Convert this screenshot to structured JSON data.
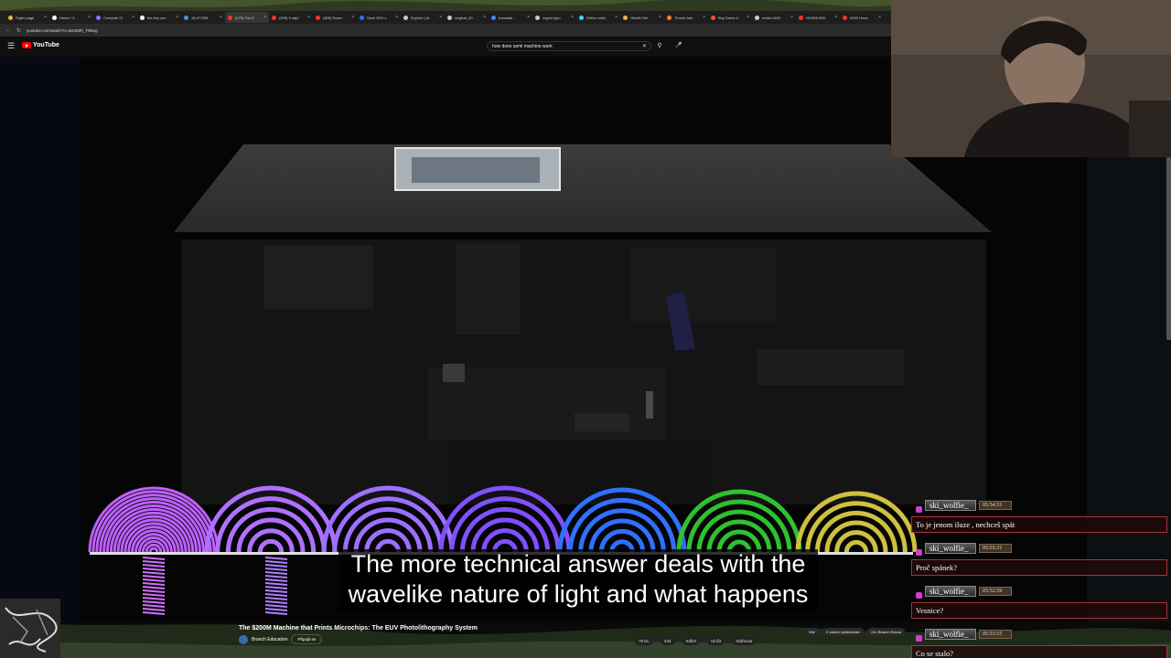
{
  "browser": {
    "tabs": [
      {
        "label": "Pajier page",
        "color": "#e8b84a"
      },
      {
        "label": "Home / X",
        "color": "#ffffff"
      },
      {
        "label": "Compute Cl",
        "color": "#7a7aff"
      },
      {
        "label": "the tiny cou",
        "color": "#ffffff"
      },
      {
        "label": "15 #71351 ",
        "color": "#4a90e2"
      },
      {
        "label": "(275) The E",
        "color": "#ff3030",
        "active": true
      },
      {
        "label": "(305) 3 najd",
        "color": "#ff3030"
      },
      {
        "label": "(305) Down",
        "color": "#ff3030"
      },
      {
        "label": "Save 20% o",
        "color": "#2f6fff"
      },
      {
        "label": "Explore | Ar",
        "color": "#cccccc"
      },
      {
        "label": "original_29",
        "color": "#cccccc"
      },
      {
        "label": "translate - ",
        "color": "#4285f4"
      },
      {
        "label": "crypto typo",
        "color": "#cccccc"
      },
      {
        "label": "Online zetic",
        "color": "#3ad8ff"
      },
      {
        "label": "Hlinčik Onl",
        "color": "#e8b84a"
      },
      {
        "label": "Trench fast",
        "color": "#ff8030"
      },
      {
        "label": "Buy Dome h",
        "color": "#ff5030"
      },
      {
        "label": "nvidia b200",
        "color": "#cccccc"
      },
      {
        "label": "NVIDIA B20",
        "color": "#ff3030"
      },
      {
        "label": "4090 Hood ",
        "color": "#ff3030"
      }
    ],
    "url": "youtube.com/watch?v=B2482h_TRkeg"
  },
  "youtube": {
    "logo_text": "YouTube",
    "search_value": "how does asml machine work",
    "video": {
      "subtitle_line1": "The more technical answer deals with the",
      "subtitle_line2": "wavelike nature of light and what happens",
      "title": "The $200M Machine that Prints Microchips: The EUV Photolithography System",
      "channel": "Branch Education",
      "join_label": "Připojit se",
      "actions": [
        "78 tis.",
        "234",
        "Sdílet",
        "Uložit",
        "Stáhnout"
      ],
      "chips": [
        "Vše",
        "Z vašich vyhledávání",
        "Od: Branch Educa"
      ],
      "arc_colors": [
        "#c060ff",
        "#b070ff",
        "#9c70ff",
        "#8050ff",
        "#3070ff",
        "#30c030",
        "#d0c040"
      ]
    }
  },
  "chat": [
    {
      "user": "ski_wolfie_",
      "time": "05:54:51",
      "message": "To je jenom iluze , nechceš spát"
    },
    {
      "user": "ski_wolfie_",
      "time": "05:55:31",
      "message": "Proč spánek?"
    },
    {
      "user": "ski_wolfie_",
      "time": "05:52:59",
      "message": "Vesnice?"
    },
    {
      "user": "ski_wolfie_",
      "time": "05:53:15",
      "message": "Co se stalo?"
    }
  ],
  "icons": {
    "menu": "hamburger-icon",
    "search": "search-icon",
    "mic": "mic-icon",
    "clear": "close-icon"
  }
}
